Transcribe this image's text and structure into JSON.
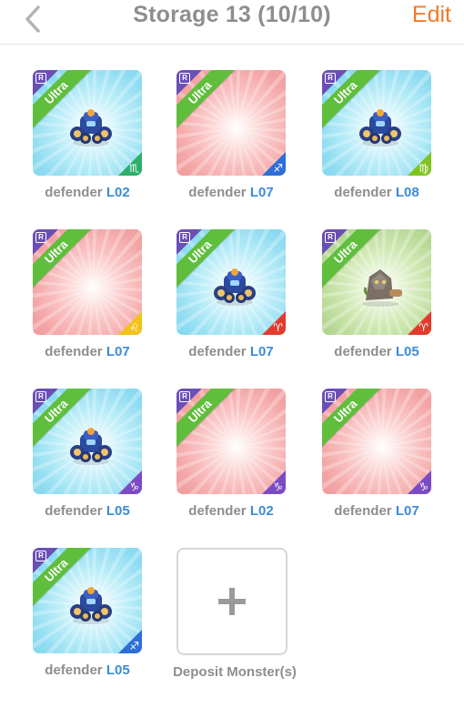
{
  "header": {
    "back_glyph": "‹",
    "title": "Storage 13 (10/10)",
    "edit_label": "Edit"
  },
  "colors": {
    "accent": "#f07a2a",
    "level_blue": "#3d8bd8",
    "ultra_green": "#5fbe3b",
    "rarity_purple": "#6a4fb6"
  },
  "items": [
    {
      "name": "defender",
      "level": "L02",
      "rank": "Ultra",
      "rarity": "R",
      "bg": "blue",
      "has_monster": true,
      "element_color": "green",
      "element_icon": "scorpio-icon",
      "element_glyph": "♏"
    },
    {
      "name": "defender",
      "level": "L07",
      "rank": "Ultra",
      "rarity": "R",
      "bg": "red",
      "has_monster": false,
      "element_color": "blue",
      "element_icon": "sagittarius-icon",
      "element_glyph": "♐"
    },
    {
      "name": "defender",
      "level": "L08",
      "rank": "Ultra",
      "rarity": "R",
      "bg": "blue",
      "has_monster": true,
      "element_color": "lime",
      "element_icon": "virgo-icon",
      "element_glyph": "♍"
    },
    {
      "name": "defender",
      "level": "L07",
      "rank": "Ultra",
      "rarity": "R",
      "bg": "red",
      "has_monster": false,
      "element_color": "yellow",
      "element_icon": "leo-icon",
      "element_glyph": "♌"
    },
    {
      "name": "defender",
      "level": "L07",
      "rank": "Ultra",
      "rarity": "R",
      "bg": "blue",
      "has_monster": true,
      "element_color": "red",
      "element_icon": "aries-icon",
      "element_glyph": "♈"
    },
    {
      "name": "defender",
      "level": "L05",
      "rank": "Ultra",
      "rarity": "R",
      "bg": "green",
      "has_monster": true,
      "element_color": "red",
      "element_icon": "aries-icon",
      "element_glyph": "♈",
      "monster_kind": "rock"
    },
    {
      "name": "defender",
      "level": "L05",
      "rank": "Ultra",
      "rarity": "R",
      "bg": "blue",
      "has_monster": true,
      "element_color": "purple",
      "element_icon": "capricorn-icon",
      "element_glyph": "♑"
    },
    {
      "name": "defender",
      "level": "L02",
      "rank": "Ultra",
      "rarity": "R",
      "bg": "red",
      "has_monster": false,
      "element_color": "purple",
      "element_icon": "capricorn-icon",
      "element_glyph": "♑"
    },
    {
      "name": "defender",
      "level": "L07",
      "rank": "Ultra",
      "rarity": "R",
      "bg": "red",
      "has_monster": false,
      "element_color": "purple",
      "element_icon": "capricorn-icon",
      "element_glyph": "♑"
    },
    {
      "name": "defender",
      "level": "L05",
      "rank": "Ultra",
      "rarity": "R",
      "bg": "blue",
      "has_monster": true,
      "element_color": "blue",
      "element_icon": "sagittarius-icon",
      "element_glyph": "♐"
    }
  ],
  "deposit": {
    "label": "Deposit Monster(s)"
  }
}
